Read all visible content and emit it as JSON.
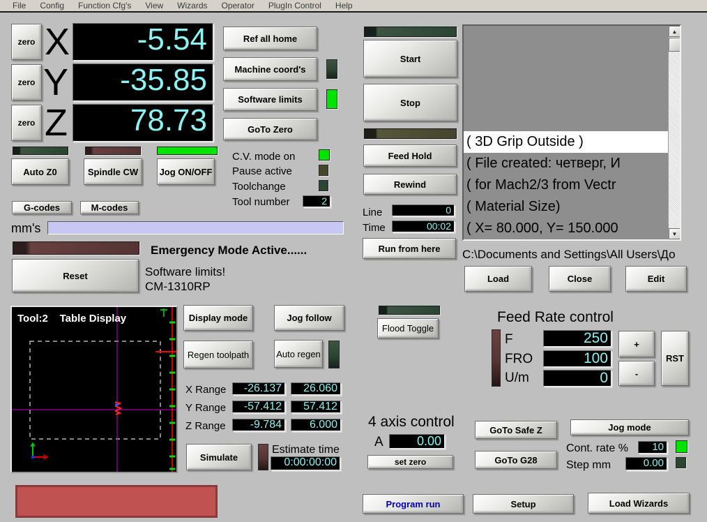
{
  "colors": {
    "background": "#bfbfbf",
    "dro_text": "#8cf2f2",
    "led_on_green": "#00e400",
    "led_off_darkgreen": "#2c4533",
    "led_off_olive": "#454530",
    "led_off_maroon": "#553434",
    "mm_field_bg": "#c7c7f3",
    "alert_box_fill": "#c05252",
    "alert_box_border": "#8b3a3a",
    "program_run_text": "#0000bb",
    "toolpath_crosshair": "#cc00cc"
  },
  "menu": {
    "items": [
      "File",
      "Config",
      "Function Cfg's",
      "View",
      "Wizards",
      "Operator",
      "PlugIn Control",
      "Help"
    ]
  },
  "dro": {
    "zero_label": "zero",
    "axes": [
      {
        "letter": "X",
        "value": "-5.54"
      },
      {
        "letter": "Y",
        "value": "-35.85"
      },
      {
        "letter": "Z",
        "value": "78.73"
      }
    ]
  },
  "buttons": {
    "ref_all_home": "Ref all home",
    "machine_coords": "Machine coord's",
    "software_limits": "Software limits",
    "goto_zero": "GoTo Zero",
    "auto_z0": "Auto Z0",
    "spindle_cw": "Spindle CW",
    "jog_onoff": "Jog ON/OFF",
    "g_codes": "G-codes",
    "m_codes": "M-codes",
    "reset": "Reset",
    "start": "Start",
    "stop": "Stop",
    "feed_hold": "Feed Hold",
    "rewind": "Rewind",
    "run_from_here": "Run from here",
    "load": "Load",
    "close": "Close",
    "edit": "Edit",
    "display_mode": "Display mode",
    "jog_follow": "Jog follow",
    "regen_toolpath": "Regen toolpath",
    "auto_regen": "Auto regen",
    "simulate": "Simulate",
    "flood_toggle": "Flood Toggle",
    "goto_safe_z": "GoTo Safe Z",
    "goto_g28": "GoTo G28",
    "jog_mode": "Jog mode",
    "set_zero": "set zero",
    "program_run": "Program run",
    "setup": "Setup",
    "load_wizards": "Load Wizards",
    "plus": "+",
    "minus": "-",
    "rst": "RST"
  },
  "status": {
    "cv_mode_label": "C.V. mode on",
    "pause_active_label": "Pause active",
    "toolchange_label": "Toolchange",
    "tool_number_label": "Tool number",
    "tool_number_value": "2"
  },
  "led_states": {
    "machine_coords": "off",
    "software_limits": "on",
    "auto_z0": "off",
    "spindle_cw": "off",
    "jog_onoff": "on",
    "cv_mode": "on",
    "pause_active": "off",
    "toolchange": "off",
    "start": "off",
    "feed_hold": "off",
    "emergency": "off",
    "flood": "off",
    "auto_regen": "off",
    "simulate": "off",
    "feed_rate": "off",
    "cont_rate": "on",
    "step": "off"
  },
  "mode_row": {
    "units_label": "mm's",
    "input_value": ""
  },
  "alerts": {
    "emergency_text": "Emergency Mode Active......",
    "limit_message": "Software limits!",
    "machine_name": "CM-1310RP"
  },
  "progress": {
    "line_label": "Line",
    "line_value": "0",
    "time_label": "Time",
    "time_value": "00:02"
  },
  "gcode": {
    "lines": [
      "( 3D Grip Outside )",
      "( File created: четверг, И",
      "( for Mach2/3 from Vectr",
      "( Material Size)",
      "( X= 80.000, Y= 150.000"
    ],
    "file_path": "C:\\Documents and Settings\\All Users\\До"
  },
  "toolpath": {
    "tool_label": "Tool:2",
    "title": "Table Display"
  },
  "ranges": {
    "x_label": "X Range",
    "x_min": "-26.137",
    "x_max": "26.060",
    "y_label": "Y Range",
    "y_min": "-57.412",
    "y_max": "57.412",
    "z_label": "Z Range",
    "z_min": "-9.784",
    "z_max": "6.000",
    "estimate_label": "Estimate time",
    "estimate_value": "0:00:00:00"
  },
  "feed_rate": {
    "title": "Feed Rate control",
    "f_label": "F",
    "f_value": "250",
    "fro_label": "FRO",
    "fro_value": "100",
    "um_label": "U/m",
    "um_value": "0"
  },
  "axis4": {
    "title": "4 axis control",
    "a_label": "A",
    "a_value": "0.00",
    "set_zero": "set zero"
  },
  "jog": {
    "cont_rate_label": "Cont. rate %",
    "cont_rate_value": "10",
    "step_label": "Step mm",
    "step_value": "0.00"
  }
}
